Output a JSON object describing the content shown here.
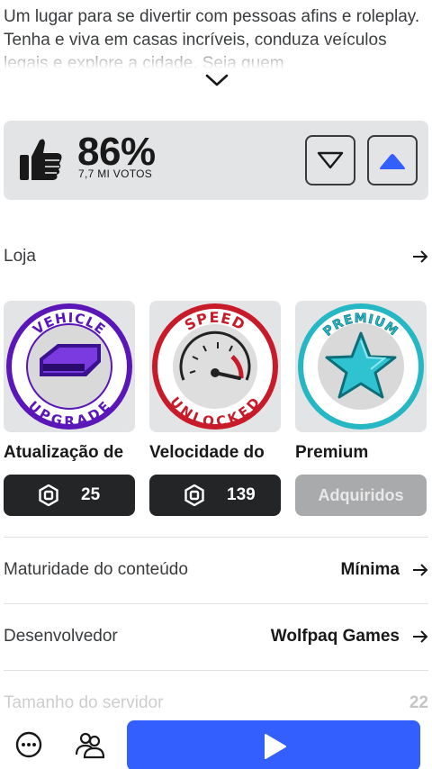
{
  "description": {
    "text": "Um lugar para se divertir com pessoas afins e roleplay. Tenha e viva em casas incríveis, conduza veículos legais e explore a cidade. Seja quem"
  },
  "rating": {
    "percent": "86%",
    "votes": "7,7 MI VOTOS"
  },
  "shop": {
    "label": "Loja"
  },
  "items": [
    {
      "name": "Atualização de",
      "price": "25",
      "badge_top": "VEHICLE",
      "badge_bottom": "UPGRADE"
    },
    {
      "name": "Velocidade do",
      "price": "139",
      "badge_top": "SPEED",
      "badge_bottom": "UNLOCKED"
    },
    {
      "name": "Premium",
      "status": "Adquiridos",
      "badge_top": "PREMIUM"
    }
  ],
  "details": {
    "maturity_label": "Maturidade do conteúdo",
    "maturity_value": "Mínima",
    "developer_label": "Desenvolvedor",
    "developer_value": "Wolfpaq Games",
    "server_size_label": "Tamanho do servidor",
    "server_size_value": "22"
  },
  "colors": {
    "accent": "#335fff",
    "card": "#e3e4e6",
    "dark_button": "#232527"
  },
  "icons": [
    "chevron-down-icon",
    "thumbs-up-icon",
    "thumbs-down-icon",
    "arrow-right-icon",
    "robux-icon",
    "more-icon",
    "friends-icon",
    "play-icon"
  ]
}
